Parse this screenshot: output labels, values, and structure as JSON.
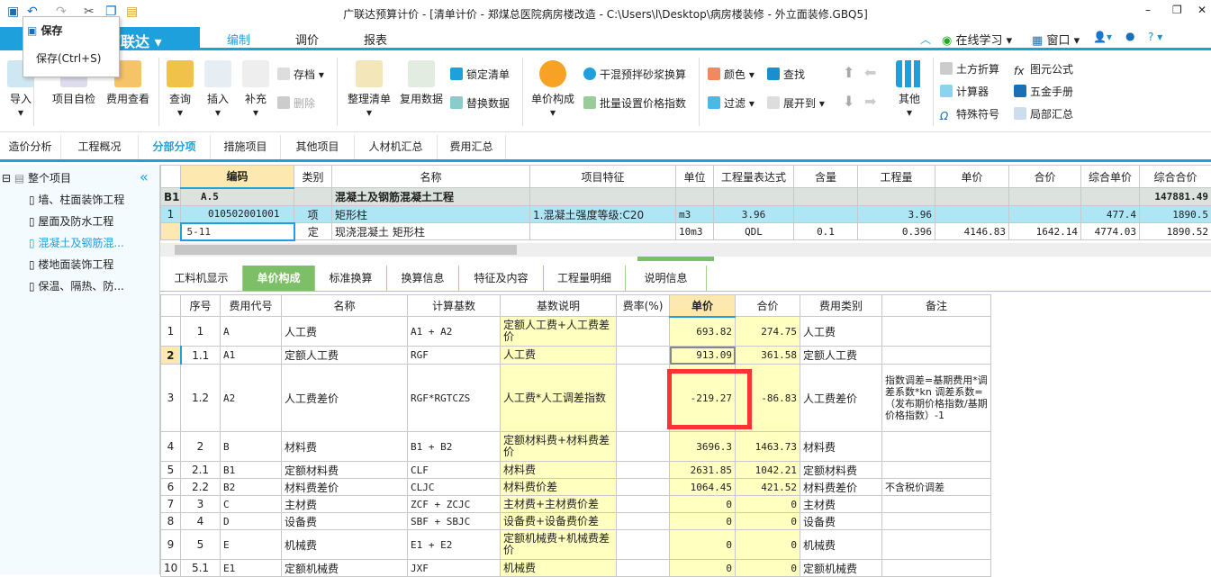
{
  "window": {
    "title": "广联达预算计价 - [清单计价 - 郑煤总医院病房楼改造 - C:\\Users\\l\\Desktop\\病房楼装修 - 外立面装修.GBQ5]"
  },
  "save_menu": {
    "header": "保存",
    "item": "保存(Ctrl+S)"
  },
  "brand": "广联达",
  "menu_tabs": [
    "编制",
    "调价",
    "报表"
  ],
  "menu_right": {
    "learn": "在线学习",
    "window": "窗口",
    "help": "?"
  },
  "ribbon": {
    "large": [
      "导入",
      "项目自检",
      "费用查看",
      "查询",
      "插入",
      "补充",
      "整理清单",
      "复用数据",
      "单价构成",
      "其他"
    ],
    "small": {
      "archive": "存档",
      "delete": "删除",
      "lock": "锁定清单",
      "replace": "替换数据",
      "mortar": "干混预拌砂浆换算",
      "batch": "批量设置价格指数",
      "color": "颜色",
      "find": "查找",
      "filter": "过滤",
      "expand": "展开到",
      "earth": "土方折算",
      "formula": "图元公式",
      "calc": "计算器",
      "hardware": "五金手册",
      "symbol": "特殊符号",
      "summary": "局部汇总"
    }
  },
  "nav_tabs": [
    "造价分析",
    "工程概况",
    "分部分项",
    "措施项目",
    "其他项目",
    "人材机汇总",
    "费用汇总"
  ],
  "tree": {
    "root": "整个项目",
    "items": [
      "墙、柱面装饰工程",
      "屋面及防水工程",
      "混凝土及钢筋混...",
      "楼地面装饰工程",
      "保温、隔热、防..."
    ],
    "selected": 2
  },
  "upper_grid": {
    "headers": [
      "",
      "编码",
      "类别",
      "名称",
      "项目特征",
      "单位",
      "工程量表达式",
      "含量",
      "工程量",
      "单价",
      "合价",
      "综合单价",
      "综合合价"
    ],
    "rows": [
      [
        "B1",
        "A.5",
        "",
        "混凝土及钢筋混凝土工程",
        "",
        "",
        "",
        "",
        "",
        "",
        "",
        "",
        "147881.49"
      ],
      [
        "1",
        "010502001001",
        "项",
        "矩形柱",
        "1.混凝土强度等级:C20",
        "m3",
        "3.96",
        "",
        "3.96",
        "",
        "",
        "477.4",
        "1890.5"
      ],
      [
        "",
        "5-11",
        "定",
        "现浇混凝土 矩形柱",
        "",
        "10m3",
        "QDL",
        "0.1",
        "0.396",
        "4146.83",
        "1642.14",
        "4774.03",
        "1890.52"
      ]
    ]
  },
  "bottom_tabs": [
    "工料机显示",
    "单价构成",
    "标准换算",
    "换算信息",
    "特征及内容",
    "工程量明细",
    "说明信息"
  ],
  "bottom_grid": {
    "headers": [
      "",
      "序号",
      "费用代号",
      "名称",
      "计算基数",
      "基数说明",
      "费率(%)",
      "单价",
      "合价",
      "费用类别",
      "备注"
    ],
    "rows": [
      [
        "1",
        "1",
        "A",
        "人工费",
        "A1 + A2",
        "定额人工费+人工费差价",
        "",
        "693.82",
        "274.75",
        "人工费",
        ""
      ],
      [
        "2",
        "1.1",
        "A1",
        "定额人工费",
        "RGF",
        "人工费",
        "",
        "913.09",
        "361.58",
        "定额人工费",
        ""
      ],
      [
        "3",
        "1.2",
        "A2",
        "人工费差价",
        "RGF*RGTCZS",
        "人工费*人工调差指数",
        "",
        "-219.27",
        "-86.83",
        "人工费差价",
        "指数调差=基期费用*调差系数*kn 调差系数=（发布期价格指数/基期价格指数）-1"
      ],
      [
        "4",
        "2",
        "B",
        "材料费",
        "B1 + B2",
        "定额材料费+材料费差价",
        "",
        "3696.3",
        "1463.73",
        "材料费",
        ""
      ],
      [
        "5",
        "2.1",
        "B1",
        "定额材料费",
        "CLF",
        "材料费",
        "",
        "2631.85",
        "1042.21",
        "定额材料费",
        ""
      ],
      [
        "6",
        "2.2",
        "B2",
        "材料费差价",
        "CLJC",
        "材料费价差",
        "",
        "1064.45",
        "421.52",
        "材料费差价",
        "不含税价调差"
      ],
      [
        "7",
        "3",
        "C",
        "主材费",
        "ZCF + ZCJC",
        "主材费+主材费价差",
        "",
        "0",
        "0",
        "主材费",
        ""
      ],
      [
        "8",
        "4",
        "D",
        "设备费",
        "SBF + SBJC",
        "设备费+设备费价差",
        "",
        "0",
        "0",
        "设备费",
        ""
      ],
      [
        "9",
        "5",
        "E",
        "机械费",
        "E1 + E2",
        "定额机械费+机械费差价",
        "",
        "0",
        "0",
        "机械费",
        ""
      ],
      [
        "10",
        "5.1",
        "E1",
        "定额机械费",
        "JXF",
        "机械费",
        "",
        "0",
        "0",
        "定额机械费",
        ""
      ]
    ]
  },
  "colors": {
    "accent": "#1ea0dc",
    "active_tab": "#7dbf66",
    "highlight": "#ffffc0",
    "row_blue": "#aee6f6",
    "annotation": "#ff3333"
  }
}
